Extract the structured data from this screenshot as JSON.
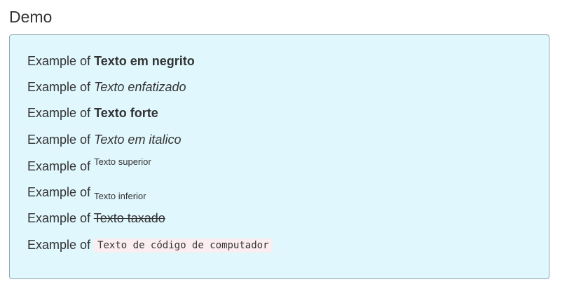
{
  "title": "Demo",
  "prefix": "Example of",
  "examples": {
    "bold": "Texto em negrito",
    "emphasized": "Texto enfatizado",
    "strong": "Texto forte",
    "italic": "Texto em italico",
    "superscript": "Texto superior",
    "subscript": "Texto inferior",
    "strikethrough": "Texto taxado",
    "code": "Texto de código de computador"
  },
  "colors": {
    "box_background": "#e0f7fd",
    "box_border": "#8fa6b3",
    "code_background": "#fbeef0",
    "text": "#333333"
  }
}
